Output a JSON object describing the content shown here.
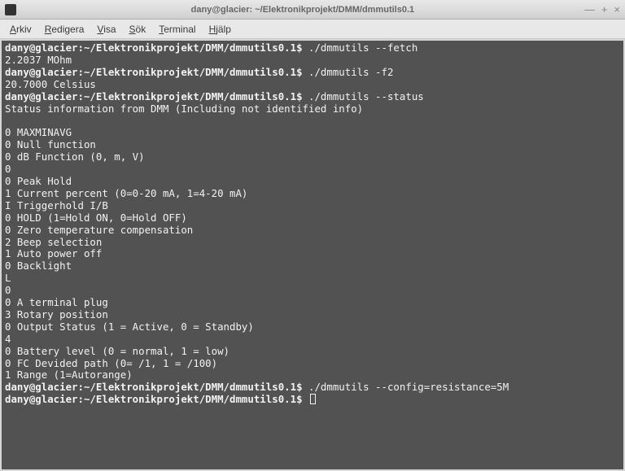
{
  "window": {
    "title": "dany@glacier: ~/Elektronikprojekt/DMM/dmmutils0.1"
  },
  "menubar": {
    "items": [
      {
        "label": "Arkiv",
        "accel": "A"
      },
      {
        "label": "Redigera",
        "accel": "R"
      },
      {
        "label": "Visa",
        "accel": "V"
      },
      {
        "label": "Sök",
        "accel": "S"
      },
      {
        "label": "Terminal",
        "accel": "T"
      },
      {
        "label": "Hjälp",
        "accel": "H"
      }
    ]
  },
  "prompt": "dany@glacier:~/Elektronikprojekt/DMM/dmmutils0.1$",
  "session": [
    {
      "type": "cmd",
      "text": "./dmmutils --fetch"
    },
    {
      "type": "out",
      "text": "2.2037 MOhm"
    },
    {
      "type": "cmd",
      "text": "./dmmutils -f2"
    },
    {
      "type": "out",
      "text": "20.7000 Celsius"
    },
    {
      "type": "cmd",
      "text": "./dmmutils --status"
    },
    {
      "type": "out",
      "text": "Status information from DMM (Including not identified info)"
    },
    {
      "type": "out",
      "text": ""
    },
    {
      "type": "out",
      "text": "0 MAXMINAVG"
    },
    {
      "type": "out",
      "text": "0 Null function"
    },
    {
      "type": "out",
      "text": "0 dB Function (0, m, V)"
    },
    {
      "type": "out",
      "text": "0"
    },
    {
      "type": "out",
      "text": "0 Peak Hold"
    },
    {
      "type": "out",
      "text": "1 Current percent (0=0-20 mA, 1=4-20 mA)"
    },
    {
      "type": "out",
      "text": "I Triggerhold I/B"
    },
    {
      "type": "out",
      "text": "0 HOLD (1=Hold ON, 0=Hold OFF)"
    },
    {
      "type": "out",
      "text": "0 Zero temperature compensation"
    },
    {
      "type": "out",
      "text": "2 Beep selection"
    },
    {
      "type": "out",
      "text": "1 Auto power off"
    },
    {
      "type": "out",
      "text": "0 Backlight"
    },
    {
      "type": "out",
      "text": "L"
    },
    {
      "type": "out",
      "text": "0"
    },
    {
      "type": "out",
      "text": "0 A terminal plug"
    },
    {
      "type": "out",
      "text": "3 Rotary position"
    },
    {
      "type": "out",
      "text": "0 Output Status (1 = Active, 0 = Standby)"
    },
    {
      "type": "out",
      "text": "4"
    },
    {
      "type": "out",
      "text": "0 Battery level (0 = normal, 1 = low)"
    },
    {
      "type": "out",
      "text": "0 FC Devided path (0= /1, 1 = /100)"
    },
    {
      "type": "out",
      "text": "1 Range (1=Autorange)"
    },
    {
      "type": "cmd",
      "text": "./dmmutils --config=resistance=5M"
    },
    {
      "type": "cmd",
      "text": "",
      "cursor": true
    }
  ]
}
